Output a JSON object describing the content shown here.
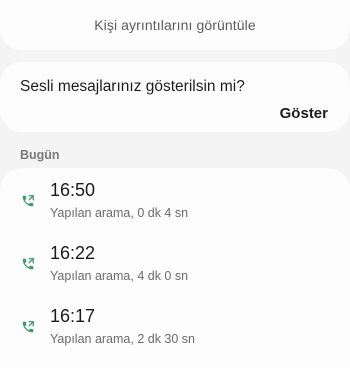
{
  "view_details": {
    "label": "Kişi ayrıntılarını görüntüle"
  },
  "voice_messages": {
    "question": "Sesli mesajlarınız gösterilsin mi?",
    "show_label": "Göster"
  },
  "section": {
    "label": "Bugün"
  },
  "calls": [
    {
      "time": "16:50",
      "description": "Yapılan arama, 0 dk 4 sn",
      "icon": "outgoing-call-icon"
    },
    {
      "time": "16:22",
      "description": "Yapılan arama, 4 dk 0 sn",
      "icon": "outgoing-call-icon"
    },
    {
      "time": "16:17",
      "description": "Yapılan arama, 2 dk 30 sn",
      "icon": "outgoing-call-icon"
    }
  ],
  "colors": {
    "background": "#f4f4f4",
    "card": "#fdfdfd",
    "call_icon": "#3f9a6a"
  }
}
